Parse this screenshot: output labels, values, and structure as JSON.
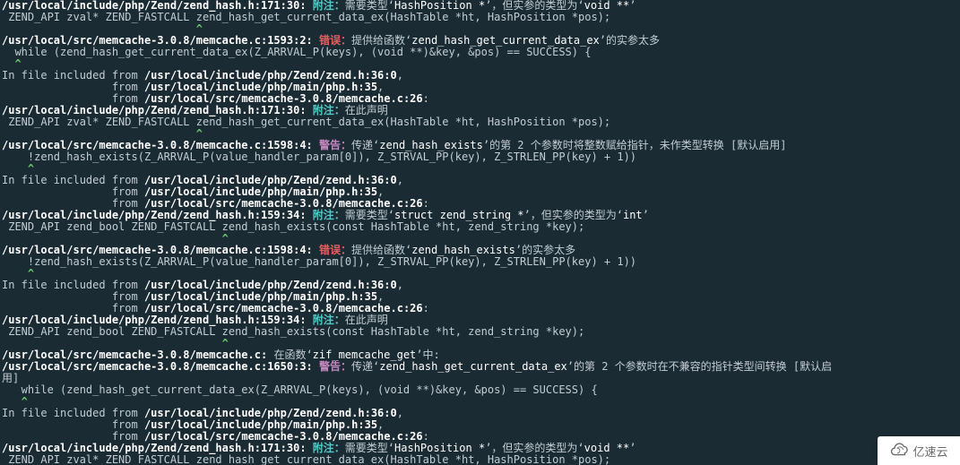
{
  "lines": [
    {
      "segs": [
        {
          "c": "path",
          "t": "/usr/local/include/php/Zend/zend_hash.h:171:30: "
        },
        {
          "c": "note",
          "t": "附注："
        },
        {
          "c": "",
          "t": "需要类型‘"
        },
        {
          "c": "tok",
          "t": "HashPosition *"
        },
        {
          "c": "",
          "t": "’，但实参的类型为‘"
        },
        {
          "c": "tok",
          "t": "void **"
        },
        {
          "c": "",
          "t": "’"
        }
      ]
    },
    {
      "segs": [
        {
          "c": "",
          "t": " ZEND_API zval* ZEND_FASTCALL zend_hash_get_current_data_ex(HashTable *ht, HashPosition *pos);"
        }
      ]
    },
    {
      "segs": [
        {
          "c": "caret",
          "t": "                              ^"
        }
      ]
    },
    {
      "segs": [
        {
          "c": "path",
          "t": "/usr/local/src/memcache-3.0.8/memcache.c:1593:2: "
        },
        {
          "c": "err",
          "t": "错误："
        },
        {
          "c": "",
          "t": "提供给函数‘"
        },
        {
          "c": "tok",
          "t": "zend_hash_get_current_data_ex"
        },
        {
          "c": "",
          "t": "’的实参太多"
        }
      ]
    },
    {
      "segs": [
        {
          "c": "",
          "t": "  while (zend_hash_get_current_data_ex(Z_ARRVAL_P(keys), (void **)&key, &pos) == SUCCESS) {"
        }
      ]
    },
    {
      "segs": [
        {
          "c": "caret",
          "t": "  ^"
        }
      ]
    },
    {
      "segs": [
        {
          "c": "",
          "t": "In file included from "
        },
        {
          "c": "path",
          "t": "/usr/local/include/php/Zend/zend.h:36:0"
        },
        {
          "c": "",
          "t": ","
        }
      ]
    },
    {
      "segs": [
        {
          "c": "",
          "t": "                 from "
        },
        {
          "c": "path",
          "t": "/usr/local/include/php/main/php.h:35"
        },
        {
          "c": "",
          "t": ","
        }
      ]
    },
    {
      "segs": [
        {
          "c": "",
          "t": "                 from "
        },
        {
          "c": "path",
          "t": "/usr/local/src/memcache-3.0.8/memcache.c:26"
        },
        {
          "c": "",
          "t": ":"
        }
      ]
    },
    {
      "segs": [
        {
          "c": "path",
          "t": "/usr/local/include/php/Zend/zend_hash.h:171:30: "
        },
        {
          "c": "note",
          "t": "附注："
        },
        {
          "c": "",
          "t": "在此声明"
        }
      ]
    },
    {
      "segs": [
        {
          "c": "",
          "t": " ZEND_API zval* ZEND_FASTCALL zend_hash_get_current_data_ex(HashTable *ht, HashPosition *pos);"
        }
      ]
    },
    {
      "segs": [
        {
          "c": "caret",
          "t": "                              ^"
        }
      ]
    },
    {
      "segs": [
        {
          "c": "path",
          "t": "/usr/local/src/memcache-3.0.8/memcache.c:1598:4: "
        },
        {
          "c": "warn",
          "t": "警告："
        },
        {
          "c": "",
          "t": "传递‘"
        },
        {
          "c": "tok",
          "t": "zend_hash_exists"
        },
        {
          "c": "",
          "t": "’的第 2 个参数时将整数赋给指针，未作类型转换 [默认启用]"
        }
      ]
    },
    {
      "segs": [
        {
          "c": "",
          "t": "    !zend_hash_exists(Z_ARRVAL_P(value_handler_param[0]), Z_STRVAL_PP(key), Z_STRLEN_PP(key) + 1))"
        }
      ]
    },
    {
      "segs": [
        {
          "c": "caret",
          "t": "    ^"
        }
      ]
    },
    {
      "segs": [
        {
          "c": "",
          "t": "In file included from "
        },
        {
          "c": "path",
          "t": "/usr/local/include/php/Zend/zend.h:36:0"
        },
        {
          "c": "",
          "t": ","
        }
      ]
    },
    {
      "segs": [
        {
          "c": "",
          "t": "                 from "
        },
        {
          "c": "path",
          "t": "/usr/local/include/php/main/php.h:35"
        },
        {
          "c": "",
          "t": ","
        }
      ]
    },
    {
      "segs": [
        {
          "c": "",
          "t": "                 from "
        },
        {
          "c": "path",
          "t": "/usr/local/src/memcache-3.0.8/memcache.c:26"
        },
        {
          "c": "",
          "t": ":"
        }
      ]
    },
    {
      "segs": [
        {
          "c": "path",
          "t": "/usr/local/include/php/Zend/zend_hash.h:159:34: "
        },
        {
          "c": "note",
          "t": "附注："
        },
        {
          "c": "",
          "t": "需要类型‘"
        },
        {
          "c": "tok",
          "t": "struct zend_string *"
        },
        {
          "c": "",
          "t": "’，但实参的类型为‘"
        },
        {
          "c": "tok",
          "t": "int"
        },
        {
          "c": "",
          "t": "’"
        }
      ]
    },
    {
      "segs": [
        {
          "c": "",
          "t": " ZEND_API zend_bool ZEND_FASTCALL zend_hash_exists(const HashTable *ht, zend_string *key);"
        }
      ]
    },
    {
      "segs": [
        {
          "c": "caret",
          "t": "                                  ^"
        }
      ]
    },
    {
      "segs": [
        {
          "c": "path",
          "t": "/usr/local/src/memcache-3.0.8/memcache.c:1598:4: "
        },
        {
          "c": "err",
          "t": "错误："
        },
        {
          "c": "",
          "t": "提供给函数‘"
        },
        {
          "c": "tok",
          "t": "zend_hash_exists"
        },
        {
          "c": "",
          "t": "’的实参太多"
        }
      ]
    },
    {
      "segs": [
        {
          "c": "",
          "t": "    !zend_hash_exists(Z_ARRVAL_P(value_handler_param[0]), Z_STRVAL_PP(key), Z_STRLEN_PP(key) + 1))"
        }
      ]
    },
    {
      "segs": [
        {
          "c": "caret",
          "t": "    ^"
        }
      ]
    },
    {
      "segs": [
        {
          "c": "",
          "t": "In file included from "
        },
        {
          "c": "path",
          "t": "/usr/local/include/php/Zend/zend.h:36:0"
        },
        {
          "c": "",
          "t": ","
        }
      ]
    },
    {
      "segs": [
        {
          "c": "",
          "t": "                 from "
        },
        {
          "c": "path",
          "t": "/usr/local/include/php/main/php.h:35"
        },
        {
          "c": "",
          "t": ","
        }
      ]
    },
    {
      "segs": [
        {
          "c": "",
          "t": "                 from "
        },
        {
          "c": "path",
          "t": "/usr/local/src/memcache-3.0.8/memcache.c:26"
        },
        {
          "c": "",
          "t": ":"
        }
      ]
    },
    {
      "segs": [
        {
          "c": "path",
          "t": "/usr/local/include/php/Zend/zend_hash.h:159:34: "
        },
        {
          "c": "note",
          "t": "附注："
        },
        {
          "c": "",
          "t": "在此声明"
        }
      ]
    },
    {
      "segs": [
        {
          "c": "",
          "t": " ZEND_API zend_bool ZEND_FASTCALL zend_hash_exists(const HashTable *ht, zend_string *key);"
        }
      ]
    },
    {
      "segs": [
        {
          "c": "caret",
          "t": "                                  ^"
        }
      ]
    },
    {
      "segs": [
        {
          "c": "path",
          "t": "/usr/local/src/memcache-3.0.8/memcache.c:"
        },
        {
          "c": "",
          "t": " 在函数‘"
        },
        {
          "c": "tok",
          "t": "zif_memcache_get"
        },
        {
          "c": "",
          "t": "’中:"
        }
      ]
    },
    {
      "segs": [
        {
          "c": "path",
          "t": "/usr/local/src/memcache-3.0.8/memcache.c:1650:3: "
        },
        {
          "c": "warn",
          "t": "警告："
        },
        {
          "c": "",
          "t": "传递‘"
        },
        {
          "c": "tok",
          "t": "zend_hash_get_current_data_ex"
        },
        {
          "c": "",
          "t": "’的第 2 个参数时在不兼容的指针类型间转换 [默认启"
        }
      ]
    },
    {
      "segs": [
        {
          "c": "",
          "t": "用]"
        }
      ]
    },
    {
      "segs": [
        {
          "c": "",
          "t": "   while (zend_hash_get_current_data_ex(Z_ARRVAL_P(keys), (void **)&key, &pos) == SUCCESS) {"
        }
      ]
    },
    {
      "segs": [
        {
          "c": "caret",
          "t": "   ^"
        }
      ]
    },
    {
      "segs": [
        {
          "c": "",
          "t": "In file included from "
        },
        {
          "c": "path",
          "t": "/usr/local/include/php/Zend/zend.h:36:0"
        },
        {
          "c": "",
          "t": ","
        }
      ]
    },
    {
      "segs": [
        {
          "c": "",
          "t": "                 from "
        },
        {
          "c": "path",
          "t": "/usr/local/include/php/main/php.h:35"
        },
        {
          "c": "",
          "t": ","
        }
      ]
    },
    {
      "segs": [
        {
          "c": "",
          "t": "                 from "
        },
        {
          "c": "path",
          "t": "/usr/local/src/memcache-3.0.8/memcache.c:26"
        },
        {
          "c": "",
          "t": ":"
        }
      ]
    },
    {
      "segs": [
        {
          "c": "path",
          "t": "/usr/local/include/php/Zend/zend_hash.h:171:30: "
        },
        {
          "c": "note",
          "t": "附注："
        },
        {
          "c": "",
          "t": "需要类型‘"
        },
        {
          "c": "tok",
          "t": "HashPosition *"
        },
        {
          "c": "",
          "t": "’，但实参的类型为‘"
        },
        {
          "c": "tok",
          "t": "void **"
        },
        {
          "c": "",
          "t": "’"
        }
      ]
    },
    {
      "segs": [
        {
          "c": "",
          "t": " ZEND_API zval* ZEND_FASTCALL zend_hash_get_current_data_ex(HashTable *ht, HashPosition *pos);"
        }
      ]
    }
  ],
  "brand": {
    "label": "亿速云"
  }
}
